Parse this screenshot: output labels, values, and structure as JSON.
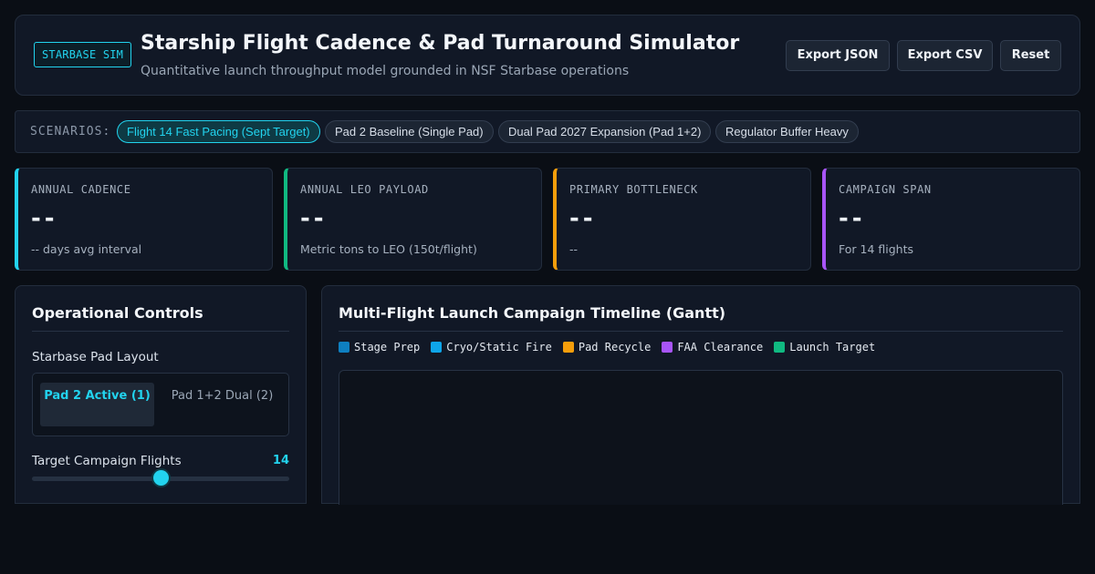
{
  "header": {
    "badge": "STARBASE SIM",
    "title": "Starship Flight Cadence & Pad Turnaround Simulator",
    "subtitle": "Quantitative launch throughput model grounded in NSF Starbase operations",
    "buttons": {
      "export_json": "Export JSON",
      "export_csv": "Export CSV",
      "reset": "Reset"
    }
  },
  "scenarios": {
    "label": "SCENARIOS:",
    "items": [
      {
        "label": "Flight 14 Fast Pacing (Sept Target)",
        "active": true
      },
      {
        "label": "Pad 2 Baseline (Single Pad)",
        "active": false
      },
      {
        "label": "Dual Pad 2027 Expansion (Pad 1+2)",
        "active": false
      },
      {
        "label": "Regulator Buffer Heavy",
        "active": false
      }
    ]
  },
  "stats": [
    {
      "label": "ANNUAL CADENCE",
      "value": "--",
      "note": "-- days avg interval",
      "color": "#22d3ee"
    },
    {
      "label": "ANNUAL LEO PAYLOAD",
      "value": "--",
      "note": "Metric tons to LEO (150t/flight)",
      "color": "#10b981"
    },
    {
      "label": "PRIMARY BOTTLENECK",
      "value": "--",
      "note": "--",
      "color": "#f59e0b"
    },
    {
      "label": "CAMPAIGN SPAN",
      "value": "--",
      "note": "For 14 flights",
      "color": "#a855f7"
    }
  ],
  "controls": {
    "title": "Operational Controls",
    "pad_layout_label": "Starbase Pad Layout",
    "pad_options": [
      "Pad 2 Active (1)",
      "Pad 1+2 Dual (2)"
    ],
    "selected_pad": "Pad 2 Active (1)",
    "flights_label": "Target Campaign Flights",
    "flights_value": "14",
    "flights_slider_fraction": 0.5
  },
  "timeline": {
    "title": "Multi-Flight Launch Campaign Timeline (Gantt)",
    "legend": [
      {
        "label": "Stage Prep",
        "color": "#0e7fc0"
      },
      {
        "label": "Cryo/Static Fire",
        "color": "#0ea5e9"
      },
      {
        "label": "Pad Recycle",
        "color": "#f59e0b"
      },
      {
        "label": "FAA Clearance",
        "color": "#a855f7"
      },
      {
        "label": "Launch Target",
        "color": "#10b981"
      }
    ]
  }
}
